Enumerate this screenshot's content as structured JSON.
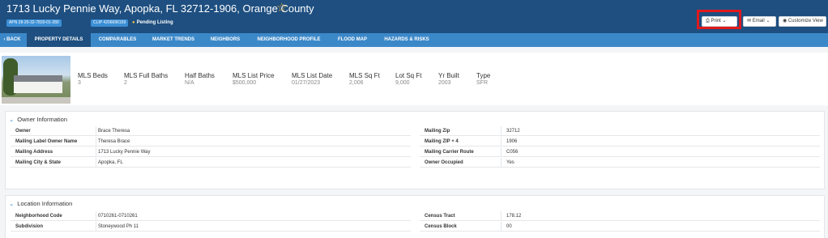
{
  "header": {
    "title": "1713 Lucky Pennie Way, Apopka, FL 32712-1906, Orange County",
    "star_icon": "star-icon",
    "badges": [
      "APN 28-20-32-7830-01-280",
      "CLIP 4206696159"
    ],
    "status": "Pending Listing",
    "buttons": {
      "print": "Print",
      "email": "Email",
      "customize": "Customize View"
    }
  },
  "nav": {
    "items": [
      "BACK",
      "PROPERTY DETAILS",
      "COMPARABLES",
      "MARKET TRENDS",
      "NEIGHBORS",
      "NEIGHBORHOOD PROFILE",
      "FLOOD MAP",
      "HAZARDS & RISKS"
    ],
    "active_index": 1
  },
  "summary": {
    "stats": [
      {
        "label": "MLS Beds",
        "value": "3"
      },
      {
        "label": "MLS Full Baths",
        "value": "2"
      },
      {
        "label": "Half Baths",
        "value": "N/A"
      },
      {
        "label": "MLS List Price",
        "value": "$500,000"
      },
      {
        "label": "MLS List Date",
        "value": "01/27/2023"
      },
      {
        "label": "MLS Sq Ft",
        "value": "2,006"
      },
      {
        "label": "Lot Sq Ft",
        "value": "9,000"
      },
      {
        "label": "Yr Built",
        "value": "2003"
      },
      {
        "label": "Type",
        "value": "SFR"
      }
    ]
  },
  "owner": {
    "title": "Owner Information",
    "left": [
      {
        "k": "Owner",
        "v": "Brace Theresa"
      },
      {
        "k": "Mailing Label Owner Name",
        "v": "Theresa Brace"
      },
      {
        "k": "Mailing Address",
        "v": "1713 Lucky Pennie Way"
      },
      {
        "k": "Mailing   City & State",
        "v": "Apopka, FL"
      }
    ],
    "right": [
      {
        "k": "Mailing Zip",
        "v": "32712"
      },
      {
        "k": "Mailing ZIP + 4",
        "v": "1906"
      },
      {
        "k": "Mailing Carrier Route",
        "v": "C056"
      },
      {
        "k": "Owner Occupied",
        "v": "Yes"
      }
    ]
  },
  "location": {
    "title": "Location Information",
    "left": [
      {
        "k": "Neighborhood Code",
        "v": "0710261-0710261"
      },
      {
        "k": "Subdivision",
        "v": "Stoneywood Ph 11"
      }
    ],
    "right": [
      {
        "k": "Census Tract",
        "v": "178.12"
      },
      {
        "k": "Census Block",
        "v": "00"
      }
    ]
  },
  "colors": {
    "header_bg": "#1e4f80",
    "nav_bg": "#3b88c9",
    "badge_bg": "#3c8fd6",
    "highlight": "#e0191c",
    "star": "#e0a52e"
  }
}
